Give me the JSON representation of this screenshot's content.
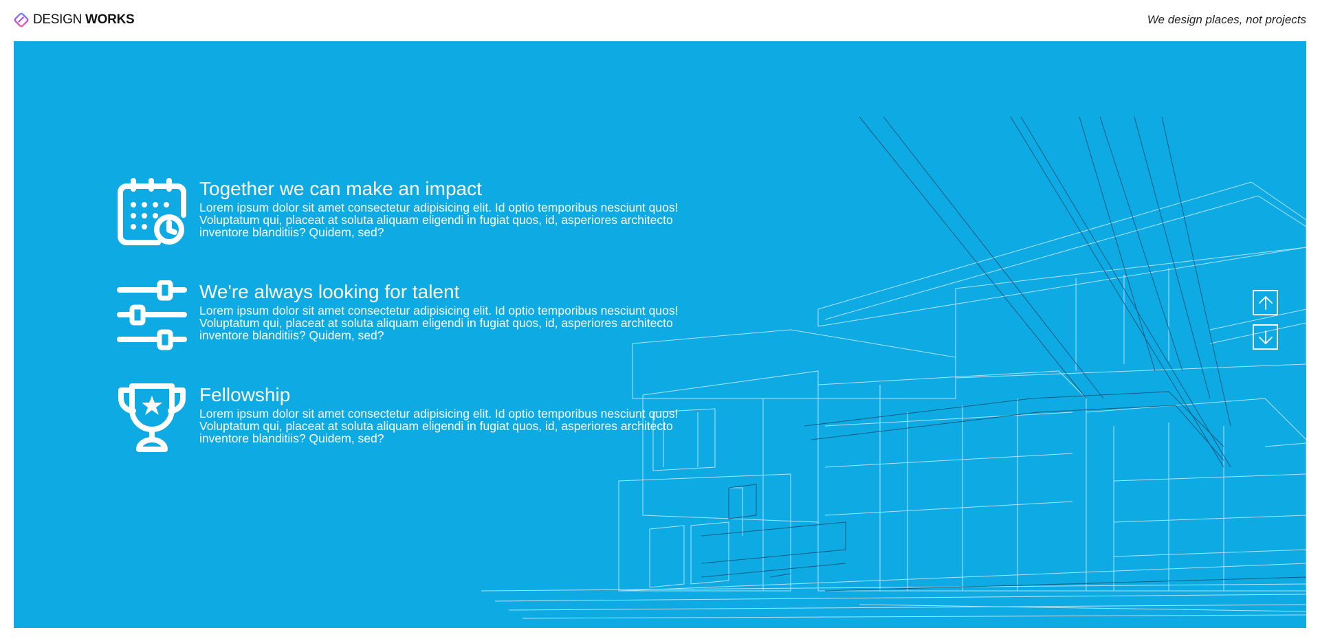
{
  "header": {
    "brand_light": "DESIGN",
    "brand_bold": "WORKS",
    "tagline": "We design places, not projects",
    "logo_icon": "design-works-logo-icon"
  },
  "hero": {
    "background_color": "#0eaae3",
    "illustration": "building-wireframe-illustration",
    "features": [
      {
        "icon": "calendar-clock-icon",
        "title": "Together we can make an impact",
        "body": "Lorem ipsum dolor sit amet consectetur adipisicing elit. Id optio temporibus nesciunt quos! Voluptatum qui, placeat at soluta aliquam eligendi in fugiat quos, id, asperiores architecto inventore blanditiis? Quidem, sed?"
      },
      {
        "icon": "sliders-icon",
        "title": "We're always looking for talent",
        "body": "Lorem ipsum dolor sit amet consectetur adipisicing elit. Id optio temporibus nesciunt quos! Voluptatum qui, placeat at soluta aliquam eligendi in fugiat quos, id, asperiores architecto inventore blanditiis? Quidem, sed?"
      },
      {
        "icon": "trophy-icon",
        "title": "Fellowship",
        "body": "Lorem ipsum dolor sit amet consectetur adipisicing elit. Id optio temporibus nesciunt quos! Voluptatum qui, placeat at soluta aliquam eligendi in fugiat quos, id, asperiores architecto inventore blanditiis? Quidem, sed?"
      }
    ],
    "nav": {
      "up_icon": "arrow-up-icon",
      "down_icon": "arrow-down-icon"
    }
  }
}
